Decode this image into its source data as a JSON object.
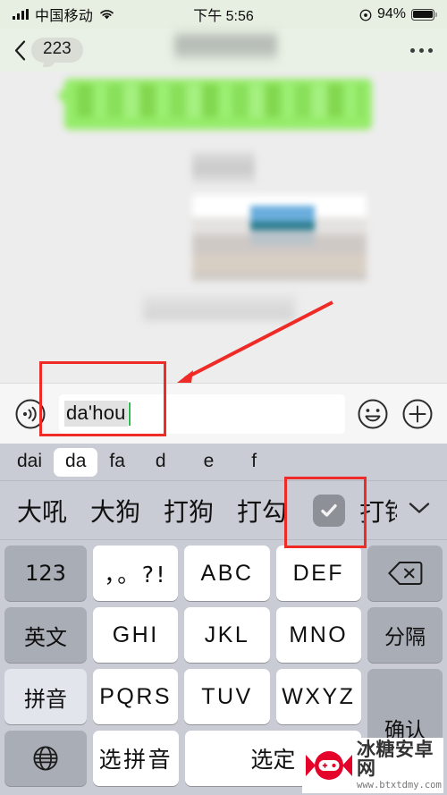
{
  "status_bar": {
    "carrier": "中国移动",
    "time": "下午 5:56",
    "battery_percent": "94%",
    "signal_icon": "signal-bars-icon",
    "wifi_icon": "wifi-icon",
    "alarm_icon": "alarm-clock-icon",
    "battery_icon": "battery-icon"
  },
  "nav_bar": {
    "back_icon": "back-chevron-icon",
    "unread_badge": "223",
    "title": "",
    "more_icon": "more-dots-icon"
  },
  "chat": {
    "outgoing_bubble_color": "#95ec69",
    "background_color": "#ededed",
    "annotation_arrow_color": "#ee2b26"
  },
  "input_bar": {
    "voice_icon": "voice-input-icon",
    "composing_text": "da'hou",
    "placeholder": "",
    "caret_color": "#2dbd4e",
    "emoji_icon": "emoji-smiley-icon",
    "add_icon": "plus-circle-icon"
  },
  "ime": {
    "pinyin_segments": [
      {
        "label": "dai",
        "active": false
      },
      {
        "label": "da",
        "active": true
      },
      {
        "label": "fa",
        "active": false
      },
      {
        "label": "d",
        "active": false
      },
      {
        "label": "e",
        "active": false
      },
      {
        "label": "f",
        "active": false
      }
    ],
    "candidates": [
      {
        "label": "大吼",
        "type": "text"
      },
      {
        "label": "大狗",
        "type": "text"
      },
      {
        "label": "打狗",
        "type": "text"
      },
      {
        "label": "打勾",
        "type": "text"
      },
      {
        "label": "",
        "type": "checkmark-emoji"
      },
      {
        "label": "打钩",
        "type": "text-clipped"
      }
    ],
    "expand_icon": "chevron-down-icon",
    "keys": {
      "row1": [
        {
          "label": "123",
          "style": "gray"
        },
        {
          "label": "，。?!",
          "style": "white"
        },
        {
          "label": "ABC",
          "style": "white"
        },
        {
          "label": "DEF",
          "style": "white"
        }
      ],
      "row2": [
        {
          "label": "英文",
          "style": "gray"
        },
        {
          "label": "GHI",
          "style": "white"
        },
        {
          "label": "JKL",
          "style": "white"
        },
        {
          "label": "MNO",
          "style": "white"
        }
      ],
      "row3": [
        {
          "label": "拼音",
          "style": "light"
        },
        {
          "label": "PQRS",
          "style": "white"
        },
        {
          "label": "TUV",
          "style": "white"
        },
        {
          "label": "WXYZ",
          "style": "white"
        }
      ],
      "row4": [
        {
          "label": "",
          "style": "gray",
          "icon": "globe-icon"
        },
        {
          "label": "选拼音",
          "style": "white"
        },
        {
          "label": "选定",
          "style": "white"
        }
      ],
      "right_column": [
        {
          "label": "",
          "style": "gray",
          "icon": "backspace-icon"
        },
        {
          "label": "分隔",
          "style": "gray"
        },
        {
          "label": "确认",
          "style": "gray"
        }
      ]
    }
  },
  "watermark": {
    "site_name": "冰糖安卓网",
    "url": "www.btxtdmy.com",
    "logo_icon": "candy-gamepad-logo-icon",
    "logo_color": "#e4022a"
  }
}
